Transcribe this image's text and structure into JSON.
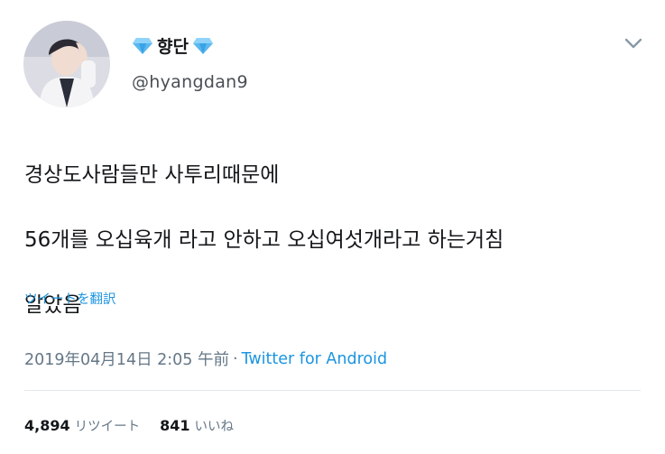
{
  "tweet": {
    "author": {
      "display_name": "향단",
      "handle": "@hyangdan9",
      "icon": "diamond-emoji"
    },
    "text_lines": [
      "경상도사람들만 사투리때문에",
      "56개를 오십육개 라고 안하고 오십여섯개라고 하는거침",
      "알았음"
    ],
    "translate_label": "ツイートを翻訳",
    "timestamp": "2019年04月14日 2:05 午前",
    "separator": "·",
    "source": "Twitter for Android",
    "stats": {
      "retweets_count": "4,894",
      "retweets_label": "リツイート",
      "likes_count": "841",
      "likes_label": "いいね"
    }
  },
  "colors": {
    "link": "#1b95e0",
    "secondary_text": "#657786",
    "primary_text": "#14171a",
    "divider": "#e1e8ed",
    "diamond": "#5bb8f0"
  }
}
